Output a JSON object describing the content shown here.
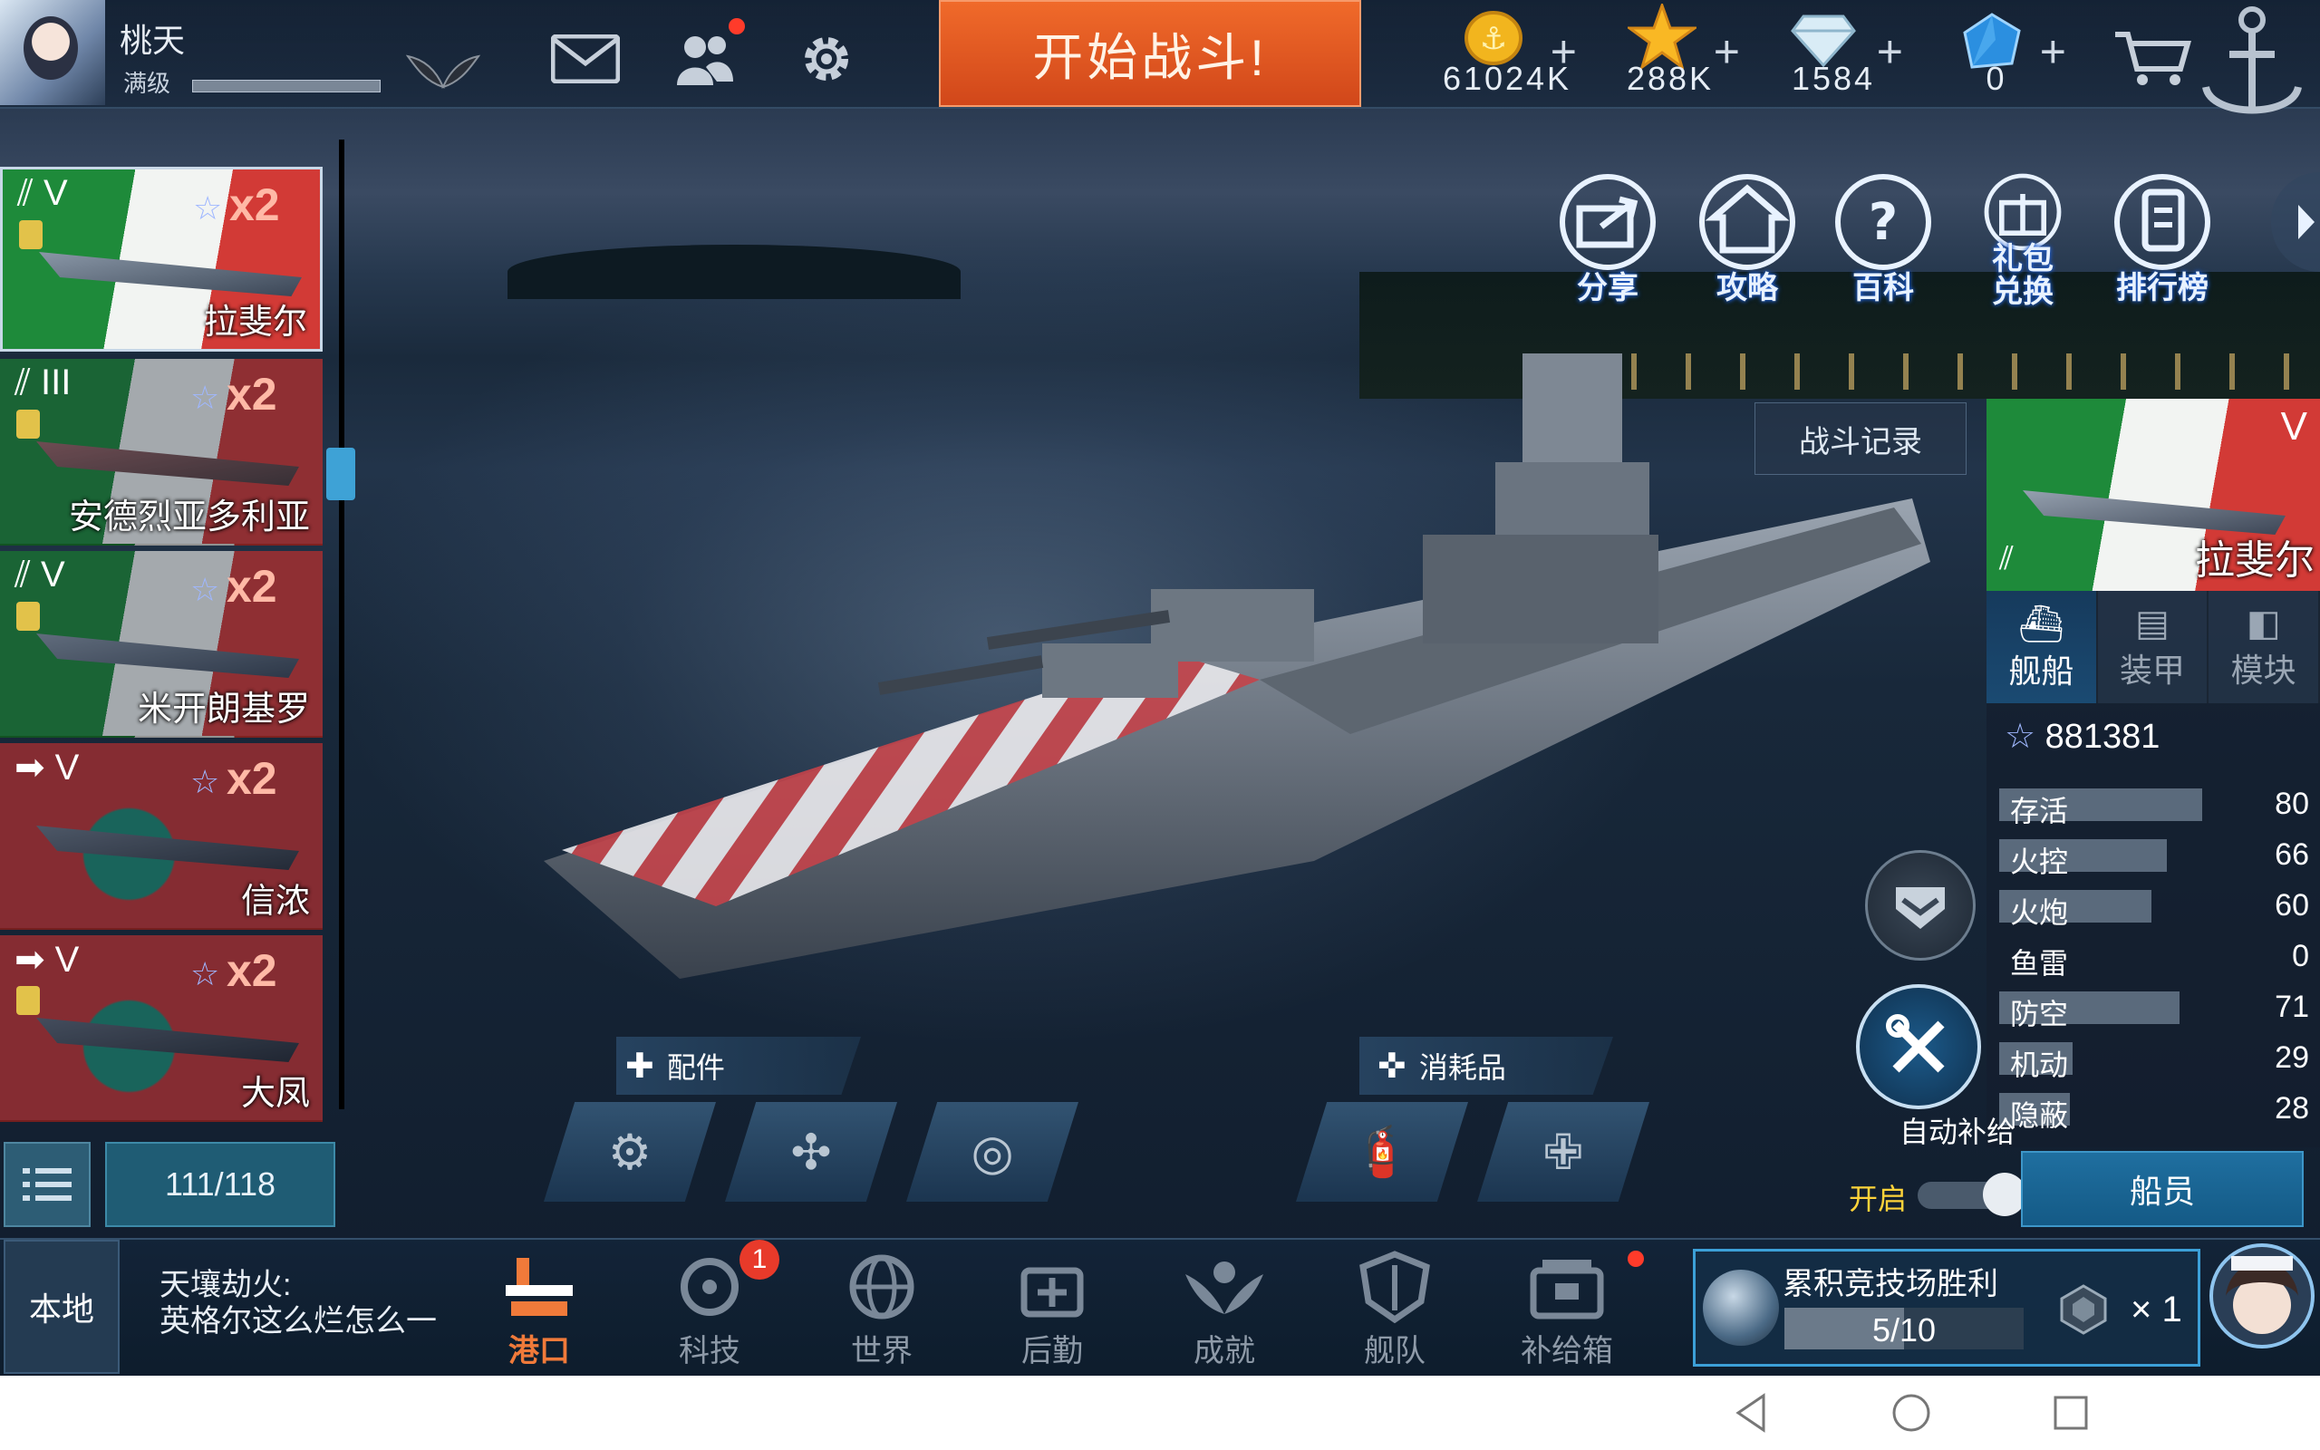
{
  "player": {
    "name": "桃天",
    "level": "满级"
  },
  "top_actions": {
    "start_battle": "开始战斗!"
  },
  "resources": [
    {
      "name": "gold",
      "icon": "gold-coin-icon",
      "value": "61024K"
    },
    {
      "name": "star",
      "icon": "star-icon",
      "value": "288K"
    },
    {
      "name": "diamond",
      "icon": "diamond-icon",
      "value": "1584"
    },
    {
      "name": "crystal",
      "icon": "blue-crystal-icon",
      "value": "0"
    }
  ],
  "functions": [
    {
      "label": "分享",
      "icon": "share-icon"
    },
    {
      "label": "攻略",
      "icon": "guide-home-icon"
    },
    {
      "label": "百科",
      "icon": "encyclopedia-icon"
    },
    {
      "label": "礼包兑换",
      "icon": "gift-redeem-icon"
    },
    {
      "label": "排行榜",
      "icon": "leaderboard-icon"
    }
  ],
  "ships": [
    {
      "tier": "V",
      "name": "拉斐尔",
      "mult": "x2",
      "flag": "italy",
      "selected": true
    },
    {
      "tier": "III",
      "name": "安德烈亚多利亚",
      "mult": "x2",
      "flag": "italy",
      "selected": false
    },
    {
      "tier": "V",
      "name": "米开朗基罗",
      "mult": "x2",
      "flag": "italy",
      "selected": false
    },
    {
      "tier": "V",
      "name": "信浓",
      "mult": "x2",
      "flag": "japan",
      "selected": false
    },
    {
      "tier": "V",
      "name": "大凤",
      "mult": "x2",
      "flag": "japan",
      "selected": false
    }
  ],
  "ship_count": "111/118",
  "battle_record": "战斗记录",
  "selected_ship": {
    "tier": "V",
    "name": "拉斐尔",
    "tabs": [
      {
        "label": "舰船"
      },
      {
        "label": "装甲"
      },
      {
        "label": "模块"
      }
    ],
    "power": "881381",
    "stats": [
      {
        "name": "存活",
        "value": "80",
        "level": 0.8
      },
      {
        "name": "火控",
        "value": "66",
        "level": 0.66
      },
      {
        "name": "火炮",
        "value": "60",
        "level": 0.6
      },
      {
        "name": "鱼雷",
        "value": "0",
        "level": 0
      },
      {
        "name": "防空",
        "value": "71",
        "level": 0.71
      },
      {
        "name": "机动",
        "value": "29",
        "level": 0.29
      },
      {
        "name": "隐蔽",
        "value": "28",
        "level": 0.28
      }
    ]
  },
  "loadout": {
    "parts_label": "配件",
    "consumables_label": "消耗品"
  },
  "auto_resupply": {
    "label": "自动补给",
    "state_label": "开启"
  },
  "crew_button": "船员",
  "chat": {
    "channel": "本地",
    "line1": "天壤劫火:",
    "line2": "英格尔这么烂怎么一"
  },
  "bottom_nav": [
    {
      "label": "港口",
      "active": true
    },
    {
      "label": "科技",
      "badge": "1"
    },
    {
      "label": "世界"
    },
    {
      "label": "后勤"
    },
    {
      "label": "成就"
    },
    {
      "label": "舰队"
    },
    {
      "label": "补给箱"
    }
  ],
  "arena": {
    "title": "累积竞技场胜利",
    "progress": "5/10",
    "progress_fraction": 0.5,
    "reward_mult": "× 1"
  },
  "colors": {
    "accent_blue": "#3ca0d8",
    "start_orange": "#e0561e",
    "notif_red": "#ff3b2a",
    "active_yellow": "#ffd33a"
  }
}
